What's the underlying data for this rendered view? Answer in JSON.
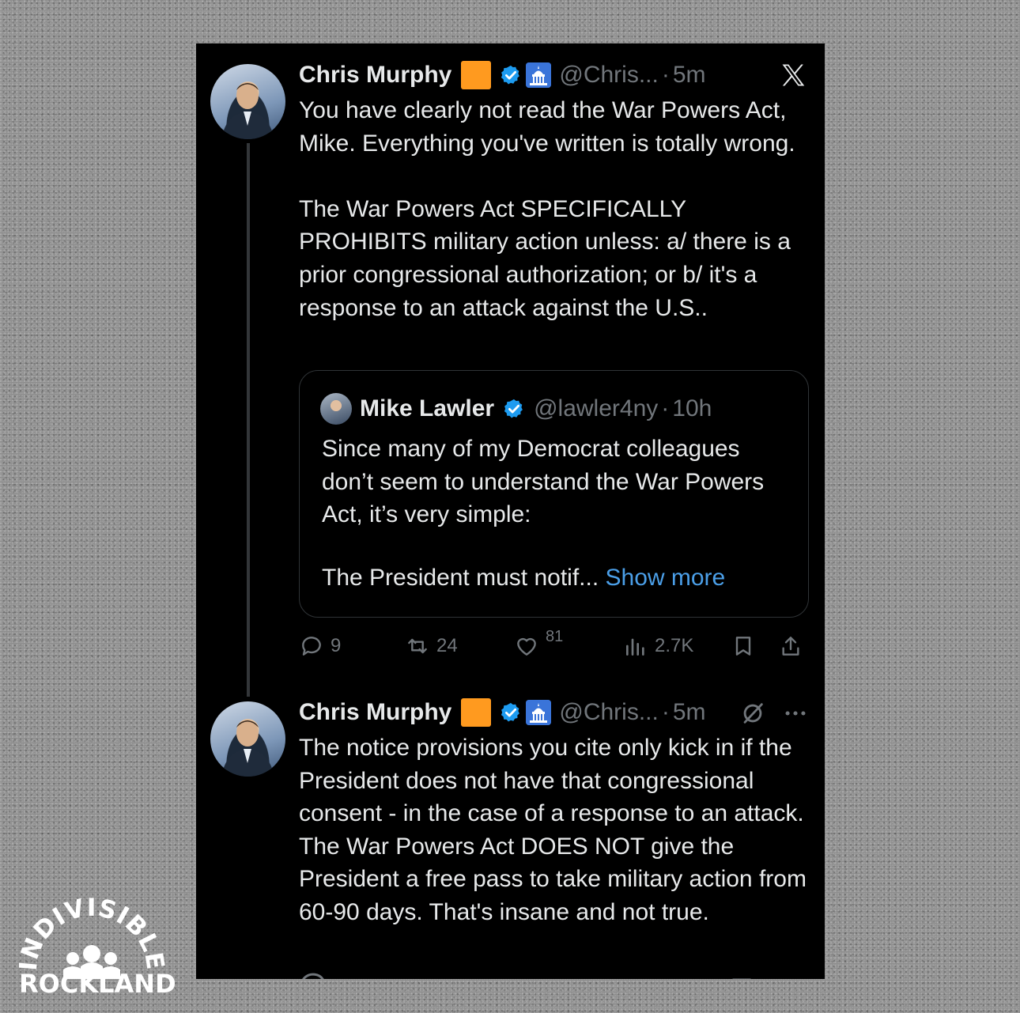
{
  "tweet1": {
    "name": "Chris Murphy",
    "handle": "@Chris...",
    "dot": "·",
    "time": "5m",
    "text": "You have clearly not read the War Powers Act, Mike. Everything you've written is totally wrong.\n\nThe War Powers Act SPECIFICALLY PROHIBITS military action unless: a/ there is a prior congressional authorization; or b/ it's a response to an attack against the U.S..",
    "quote": {
      "name": "Mike Lawler",
      "handle": "@lawler4ny",
      "dot": "·",
      "time": "10h",
      "text": "Since many of my Democrat colleagues don’t seem to understand the War Powers Act, it’s very simple:",
      "last_line": "The President must notif...",
      "show_more": "Show more"
    },
    "actions": {
      "replies": "9",
      "reposts": "24",
      "likes": "81",
      "views": "2.7K"
    }
  },
  "tweet2": {
    "name": "Chris Murphy",
    "handle": "@Chris...",
    "dot": "·",
    "time": "5m",
    "text": "The notice provisions you cite only kick in if the President does not have that congressional consent - in the case of a response to an attack. The War Powers Act DOES NOT give the President a free pass to take military action from 60-90 days. That's insane and not true."
  },
  "icons": {
    "flag": "orange-square-emoji",
    "verified": "verified-badge-icon",
    "capitol": "capitol-emoji",
    "x_logo": "x-logo-icon",
    "grok": "grok-icon",
    "more": "more-icon"
  },
  "logo": {
    "arc_text": "INDIVISIBLE",
    "bottom_text": "ROCKLAND"
  },
  "colors": {
    "background": "#000000",
    "text": "#e7e9ea",
    "muted": "#71767b",
    "link": "#4b9fe8",
    "verified": "#1d9bf0",
    "flag": "#ff9a1f"
  }
}
